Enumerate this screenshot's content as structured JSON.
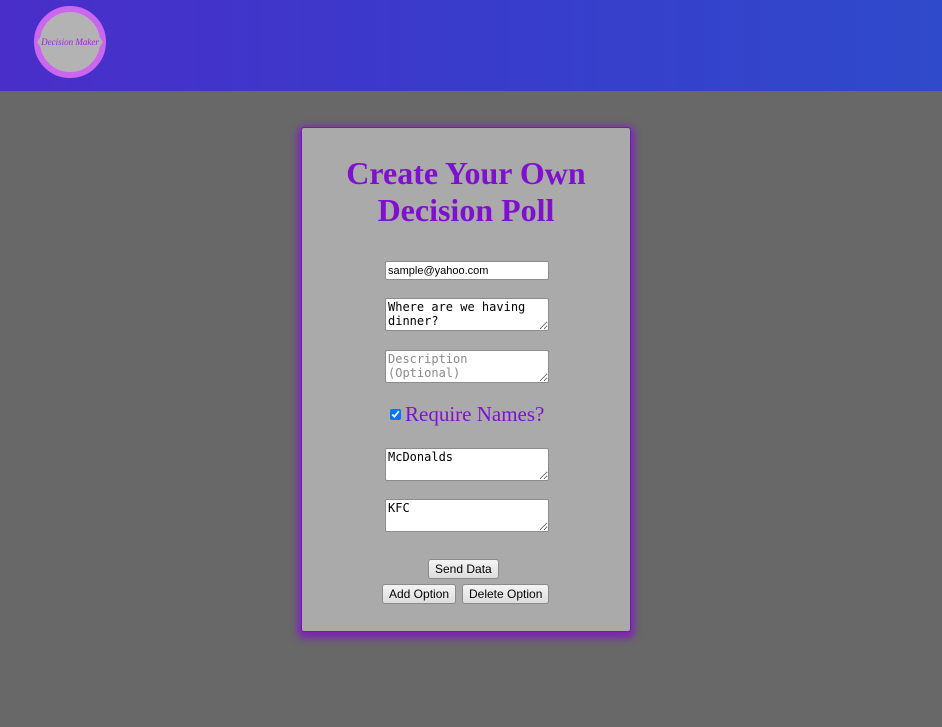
{
  "header": {
    "logo_text": "Decision Maker",
    "brand_colors": {
      "logo_ring": "#cc66ee",
      "logo_hex": "#b3b3b3",
      "logo_text": "#a020f0"
    }
  },
  "form": {
    "title_line1": "Create Your Own",
    "title_line2": "Decision Poll",
    "email_value": "sample@yahoo.com",
    "question_value": "Where are we having dinner?",
    "description_placeholder": "Description (Optional)",
    "require_names_checked": true,
    "require_names_label": "Require Names?",
    "options": [
      {
        "value": "McDonalds"
      },
      {
        "value": "KFC"
      }
    ],
    "send_button_label": "Send Data",
    "add_option_label": "Add Option",
    "delete_option_label": "Delete Option"
  },
  "colors": {
    "accent": "#8010d0",
    "page_background": "#686868",
    "card_background": "#aaaaaa"
  }
}
